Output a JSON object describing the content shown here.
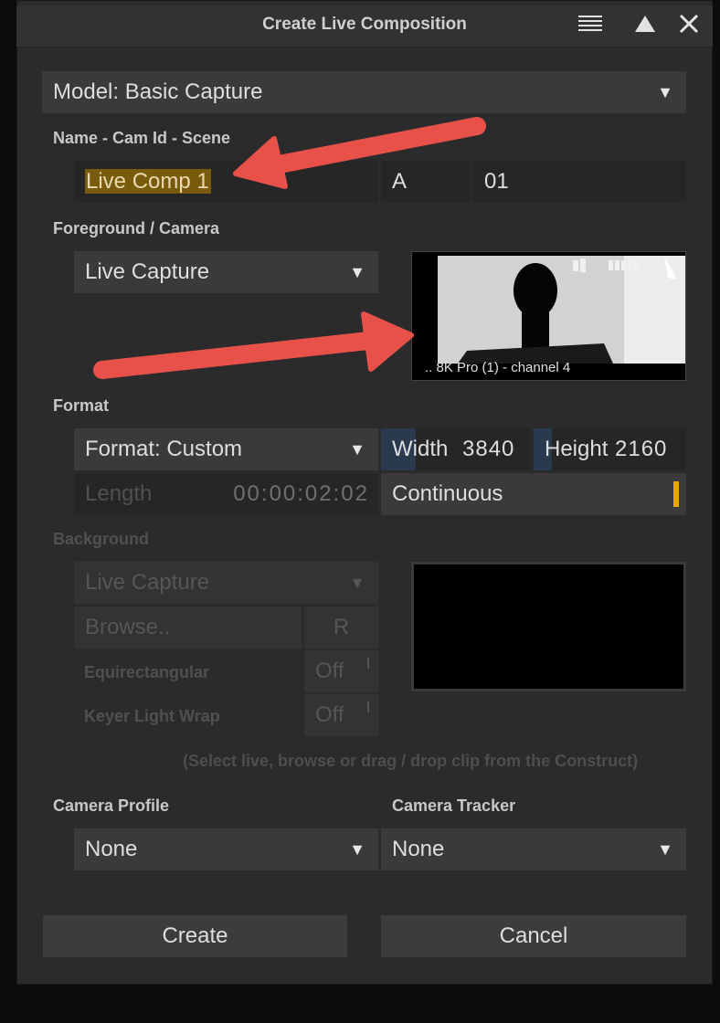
{
  "dialog": {
    "title": "Create Live Composition"
  },
  "model": {
    "value": "Model: Basic Capture"
  },
  "name_section": {
    "label": "Name - Cam Id - Scene",
    "name_value": "Live Comp 1",
    "cam_id": "A",
    "scene": "01"
  },
  "foreground": {
    "label": "Foreground / Camera",
    "source": "Live Capture",
    "preview_caption": ".. 8K Pro (1) - channel 4"
  },
  "format": {
    "label": "Format",
    "format_value": "Format: Custom",
    "width_label": "Width",
    "width_value": "3840",
    "height_label": "Height",
    "height_value": "2160",
    "length_label": "Length",
    "length_value": "00:00:02:02",
    "mode": "Continuous"
  },
  "background": {
    "label": "Background",
    "source": "Live Capture",
    "browse": "Browse..",
    "reset": "R",
    "equirect_label": "Equirectangular",
    "equirect_value": "Off",
    "keyer_label": "Keyer Light Wrap",
    "keyer_value": "Off",
    "hint": "(Select live, browse or drag / drop clip from the Construct)"
  },
  "camera_profile": {
    "label": "Camera Profile",
    "value": "None"
  },
  "camera_tracker": {
    "label": "Camera Tracker",
    "value": "None"
  },
  "actions": {
    "create": "Create",
    "cancel": "Cancel"
  },
  "colors": {
    "accent": "#e8a800",
    "arrow": "#e8504a",
    "highlight": "#7a5a0c"
  }
}
